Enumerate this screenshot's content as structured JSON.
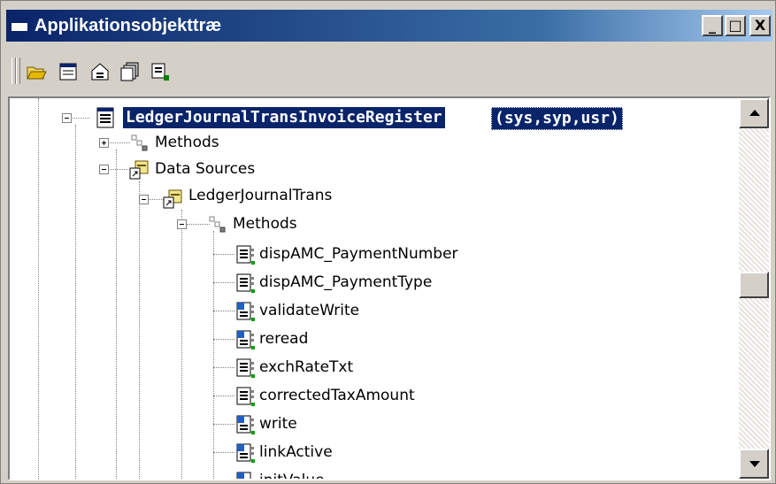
{
  "window": {
    "title": "Applikationsobjekttræ",
    "buttons": {
      "minimize": "_",
      "maximize": "□",
      "close": "X"
    }
  },
  "toolbar": {
    "icons": [
      "open-icon",
      "properties-list-icon",
      "properties-icon",
      "duplicate-icon",
      "compile-icon"
    ]
  },
  "tree": {
    "root": {
      "label": "LedgerJournalTransInvoiceRegister",
      "suffix": "(sys,syp,usr)",
      "expanded": true
    },
    "methods": {
      "label": "Methods",
      "expanded": false
    },
    "data_sources": {
      "label": "Data Sources",
      "expanded": true
    },
    "ledger_journal_trans": {
      "label": "LedgerJournalTrans",
      "expanded": true
    },
    "ds_methods": {
      "label": "Methods",
      "expanded": true
    },
    "method_items": [
      {
        "label": "dispAMC_PaymentNumber",
        "kind": "custom"
      },
      {
        "label": "dispAMC_PaymentType",
        "kind": "custom"
      },
      {
        "label": "validateWrite",
        "kind": "override"
      },
      {
        "label": "reread",
        "kind": "override"
      },
      {
        "label": "exchRateTxt",
        "kind": "custom"
      },
      {
        "label": "correctedTaxAmount",
        "kind": "custom"
      },
      {
        "label": "write",
        "kind": "override"
      },
      {
        "label": "linkActive",
        "kind": "override"
      },
      {
        "label": "initValue",
        "kind": "override"
      }
    ]
  },
  "colors": {
    "titlebar": "#0a246a",
    "selection": "#0a246a",
    "face": "#d4d0c8"
  }
}
